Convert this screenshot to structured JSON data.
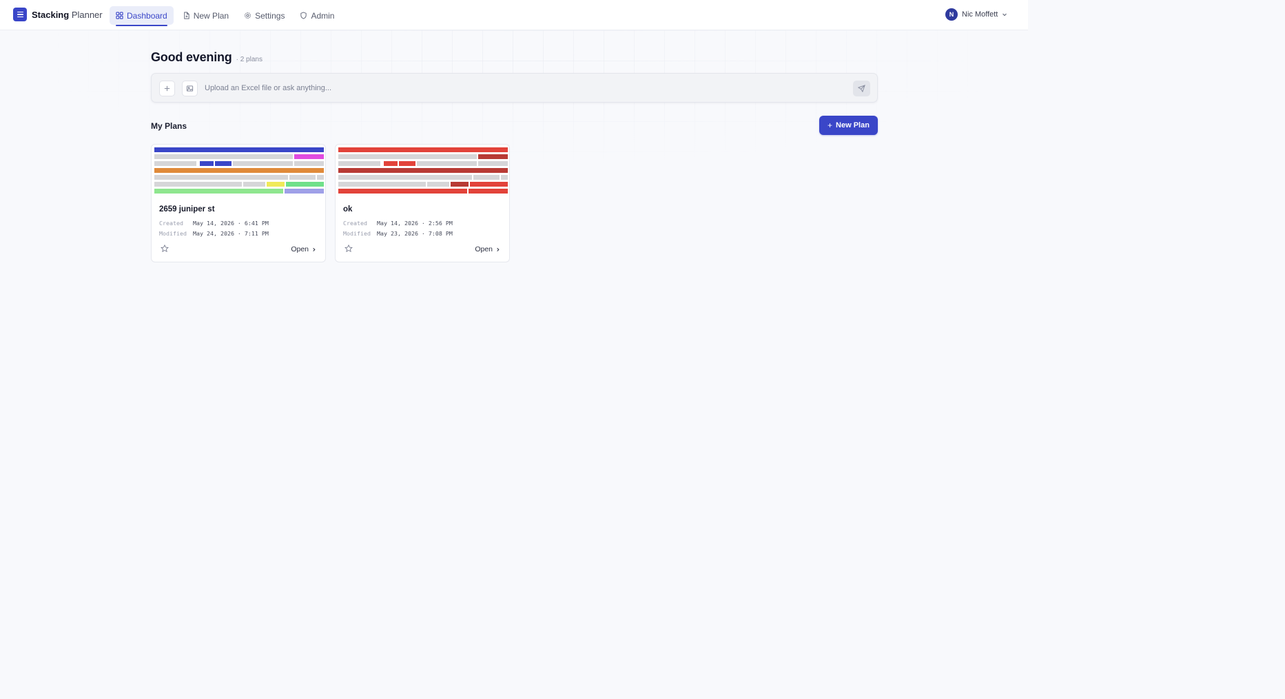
{
  "app": {
    "name_bold": "Stacking",
    "name_light": "Planner"
  },
  "nav": {
    "dashboard": "Dashboard",
    "new_plan": "New Plan",
    "settings": "Settings",
    "admin": "Admin"
  },
  "user": {
    "initial": "N",
    "name": "Nic Moffett"
  },
  "greeting": {
    "title": "Good evening",
    "count": "· 2 plans"
  },
  "ask": {
    "placeholder": "Upload an Excel file or ask anything..."
  },
  "plans_section": {
    "title": "My Plans",
    "new_plan_label": "New Plan"
  },
  "plans": [
    {
      "title": "2659 juniper st",
      "created_label": "Created",
      "created": "May 14, 2026 · 6:41 PM",
      "modified_label": "Modified",
      "modified": "May 24, 2026 · 7:11 PM",
      "open_label": "Open"
    },
    {
      "title": "ok",
      "created_label": "Created",
      "created": "May 14, 2026 · 2:56 PM",
      "modified_label": "Modified",
      "modified": "May 23, 2026 · 7:08 PM",
      "open_label": "Open"
    }
  ],
  "colors": {
    "accent": "#3a46c8",
    "plan1": [
      "#3a46c8",
      "#e04ce0",
      "#e08a3a",
      "#f0ea5a",
      "#6fe08a",
      "#9fa0e8",
      "#8fe68f"
    ],
    "plan2": [
      "#e2433a",
      "#b83a34"
    ]
  },
  "icons": {
    "logo": "list-icon",
    "dashboard": "grid-icon",
    "new_plan": "file-plus-icon",
    "settings": "gear-icon",
    "admin": "shield-icon",
    "attach": "plus-icon",
    "image": "image-icon",
    "send": "send-icon",
    "star": "star-icon",
    "open": "chevron-right-icon",
    "user_menu": "chevron-down-icon"
  }
}
